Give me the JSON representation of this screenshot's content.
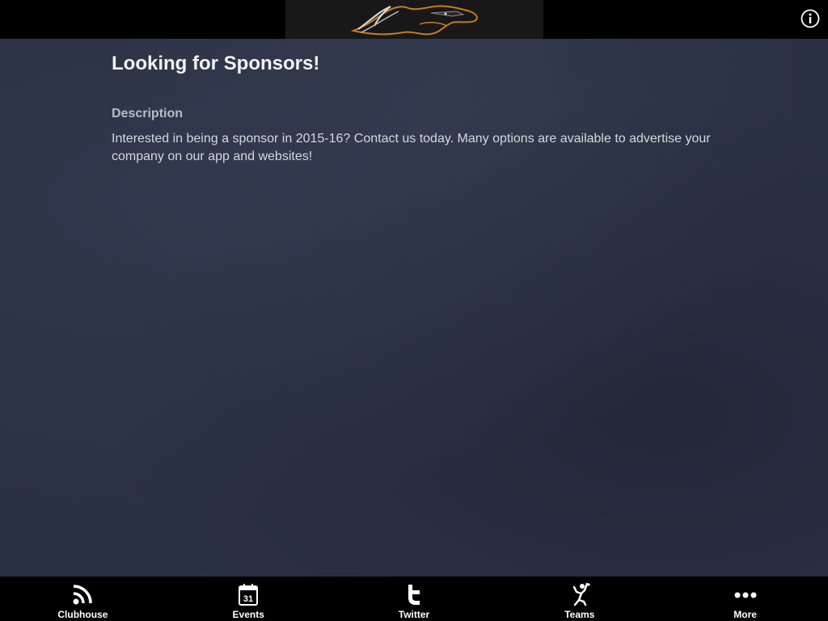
{
  "header": {
    "logo_icon": "mustang-horse-logo",
    "info_icon": "info-icon"
  },
  "main": {
    "title": "Looking for Sponsors!",
    "section_label": "Description",
    "description": "Interested in being a sponsor in 2015-16? Contact us today. Many options are available to advertise your company on our app and websites!"
  },
  "tabbar": {
    "tabs": [
      {
        "label": "Clubhouse",
        "icon": "rss-feed-icon"
      },
      {
        "label": "Events",
        "icon": "calendar-icon",
        "icon_text": "31"
      },
      {
        "label": "Twitter",
        "icon": "twitter-icon"
      },
      {
        "label": "Teams",
        "icon": "athlete-icon"
      },
      {
        "label": "More",
        "icon": "more-dots-icon"
      }
    ]
  },
  "colors": {
    "background": "#2b3144",
    "bar": "#000000",
    "logo_accent": "#c97a1e"
  }
}
